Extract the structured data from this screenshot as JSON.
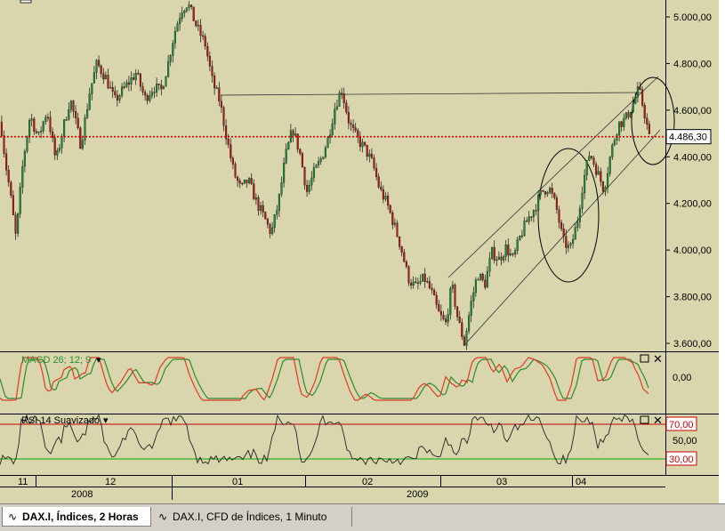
{
  "chart_data": {
    "type": "candlestick",
    "instrument": "DAX.I, Índices, 2 Horas",
    "price_axis": {
      "ticks": [
        "5.000,00",
        "4.800,00",
        "4.600,00",
        "4.400,00",
        "4.200,00",
        "4.000,00",
        "3.800,00",
        "3.600,00"
      ],
      "tick_values": [
        5000,
        4800,
        4600,
        4400,
        4200,
        4000,
        3800,
        3600
      ],
      "ylim": [
        3575,
        5075
      ],
      "current_price_label": "4.486,30",
      "current_price": 4486.3
    },
    "time_axis": {
      "months": [
        "11",
        "12",
        "01",
        "02",
        "03",
        "04"
      ],
      "years": [
        "2008",
        "2009"
      ]
    },
    "price_series_keypoints": [
      {
        "x": 0,
        "y": 4550
      },
      {
        "x": 5,
        "y": 4380
      },
      {
        "x": 10,
        "y": 4260
      },
      {
        "x": 17,
        "y": 4050
      },
      {
        "x": 25,
        "y": 4380
      },
      {
        "x": 33,
        "y": 4580
      },
      {
        "x": 42,
        "y": 4480
      },
      {
        "x": 52,
        "y": 4600
      },
      {
        "x": 62,
        "y": 4380
      },
      {
        "x": 70,
        "y": 4520
      },
      {
        "x": 78,
        "y": 4650
      },
      {
        "x": 90,
        "y": 4450
      },
      {
        "x": 100,
        "y": 4680
      },
      {
        "x": 108,
        "y": 4800
      },
      {
        "x": 118,
        "y": 4740
      },
      {
        "x": 128,
        "y": 4640
      },
      {
        "x": 140,
        "y": 4700
      },
      {
        "x": 152,
        "y": 4760
      },
      {
        "x": 162,
        "y": 4650
      },
      {
        "x": 172,
        "y": 4700
      },
      {
        "x": 180,
        "y": 4680
      },
      {
        "x": 188,
        "y": 4800
      },
      {
        "x": 195,
        "y": 4930
      },
      {
        "x": 203,
        "y": 5030
      },
      {
        "x": 210,
        "y": 5060
      },
      {
        "x": 220,
        "y": 4960
      },
      {
        "x": 230,
        "y": 4880
      },
      {
        "x": 238,
        "y": 4720
      },
      {
        "x": 246,
        "y": 4640
      },
      {
        "x": 254,
        "y": 4480
      },
      {
        "x": 262,
        "y": 4330
      },
      {
        "x": 270,
        "y": 4260
      },
      {
        "x": 278,
        "y": 4300
      },
      {
        "x": 288,
        "y": 4200
      },
      {
        "x": 296,
        "y": 4140
      },
      {
        "x": 304,
        "y": 4070
      },
      {
        "x": 312,
        "y": 4200
      },
      {
        "x": 320,
        "y": 4400
      },
      {
        "x": 328,
        "y": 4520
      },
      {
        "x": 336,
        "y": 4420
      },
      {
        "x": 344,
        "y": 4250
      },
      {
        "x": 352,
        "y": 4330
      },
      {
        "x": 360,
        "y": 4390
      },
      {
        "x": 368,
        "y": 4480
      },
      {
        "x": 376,
        "y": 4620
      },
      {
        "x": 383,
        "y": 4690
      },
      {
        "x": 392,
        "y": 4540
      },
      {
        "x": 400,
        "y": 4480
      },
      {
        "x": 410,
        "y": 4430
      },
      {
        "x": 418,
        "y": 4370
      },
      {
        "x": 426,
        "y": 4260
      },
      {
        "x": 434,
        "y": 4200
      },
      {
        "x": 442,
        "y": 4110
      },
      {
        "x": 450,
        "y": 4010
      },
      {
        "x": 458,
        "y": 3880
      },
      {
        "x": 466,
        "y": 3840
      },
      {
        "x": 476,
        "y": 3880
      },
      {
        "x": 484,
        "y": 3820
      },
      {
        "x": 492,
        "y": 3730
      },
      {
        "x": 500,
        "y": 3680
      },
      {
        "x": 507,
        "y": 3850
      },
      {
        "x": 514,
        "y": 3700
      },
      {
        "x": 521,
        "y": 3600
      },
      {
        "x": 528,
        "y": 3760
      },
      {
        "x": 536,
        "y": 3900
      },
      {
        "x": 544,
        "y": 3850
      },
      {
        "x": 552,
        "y": 3990
      },
      {
        "x": 560,
        "y": 3960
      },
      {
        "x": 568,
        "y": 4010
      },
      {
        "x": 576,
        "y": 3960
      },
      {
        "x": 584,
        "y": 4060
      },
      {
        "x": 592,
        "y": 4130
      },
      {
        "x": 600,
        "y": 4180
      },
      {
        "x": 608,
        "y": 4250
      },
      {
        "x": 616,
        "y": 4270
      },
      {
        "x": 624,
        "y": 4190
      },
      {
        "x": 632,
        "y": 4040
      },
      {
        "x": 640,
        "y": 4000
      },
      {
        "x": 648,
        "y": 4120
      },
      {
        "x": 654,
        "y": 4280
      },
      {
        "x": 662,
        "y": 4420
      },
      {
        "x": 670,
        "y": 4340
      },
      {
        "x": 678,
        "y": 4260
      },
      {
        "x": 686,
        "y": 4420
      },
      {
        "x": 694,
        "y": 4540
      },
      {
        "x": 702,
        "y": 4560
      },
      {
        "x": 710,
        "y": 4620
      },
      {
        "x": 717,
        "y": 4690
      },
      {
        "x": 723,
        "y": 4600
      },
      {
        "x": 729,
        "y": 4480
      }
    ],
    "macd": {
      "label": "MACD 26; 12; 9",
      "ticks": [
        "0,00"
      ]
    },
    "rsi": {
      "label": "RSI 14 Suavizado",
      "ticks": [
        "70,00",
        "50,00",
        "30,00"
      ]
    }
  },
  "tabs": [
    {
      "label": "DAX.I, Índices, 2 Horas",
      "active": true
    },
    {
      "label": "DAX.I, CFD de Índices, 1 Minuto",
      "active": false
    }
  ],
  "colors": {
    "background": "#d9d6ad",
    "bull": "#1a8a3a",
    "bear": "#b01818",
    "macd_line": "#e03a24",
    "signal_line": "#2f8a2f",
    "price_line": "#e00000",
    "rsi_high": "#cc0000",
    "rsi_low": "#00aa00"
  }
}
